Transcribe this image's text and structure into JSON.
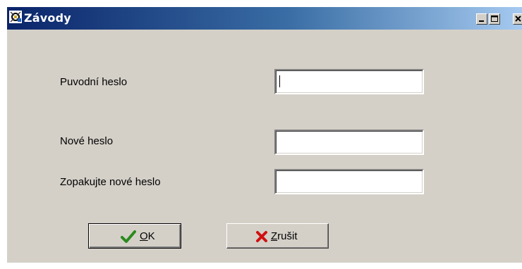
{
  "window": {
    "title": "Závody",
    "app_icon": "gear-wrench-icon",
    "controls": {
      "minimize_icon": "minimize-icon",
      "maximize_icon": "maximize-icon",
      "close_icon": "close-icon"
    }
  },
  "form": {
    "old_password_label": "Puvodní heslo",
    "old_password_value": "",
    "new_password_label": "Nové heslo",
    "new_password_value": "",
    "confirm_password_label": "Zopakujte nové heslo",
    "confirm_password_value": ""
  },
  "buttons": {
    "ok": {
      "mnemonic": "O",
      "rest": "K",
      "icon": "checkmark-icon",
      "icon_color": "#2a8a1c"
    },
    "cancel": {
      "mnemonic": "Z",
      "rest": "rušit",
      "icon": "red-x-icon",
      "icon_color": "#d01010"
    }
  },
  "colors": {
    "face": "#d4d0c8",
    "title_start": "#0a246a",
    "title_end": "#a6caf0"
  }
}
